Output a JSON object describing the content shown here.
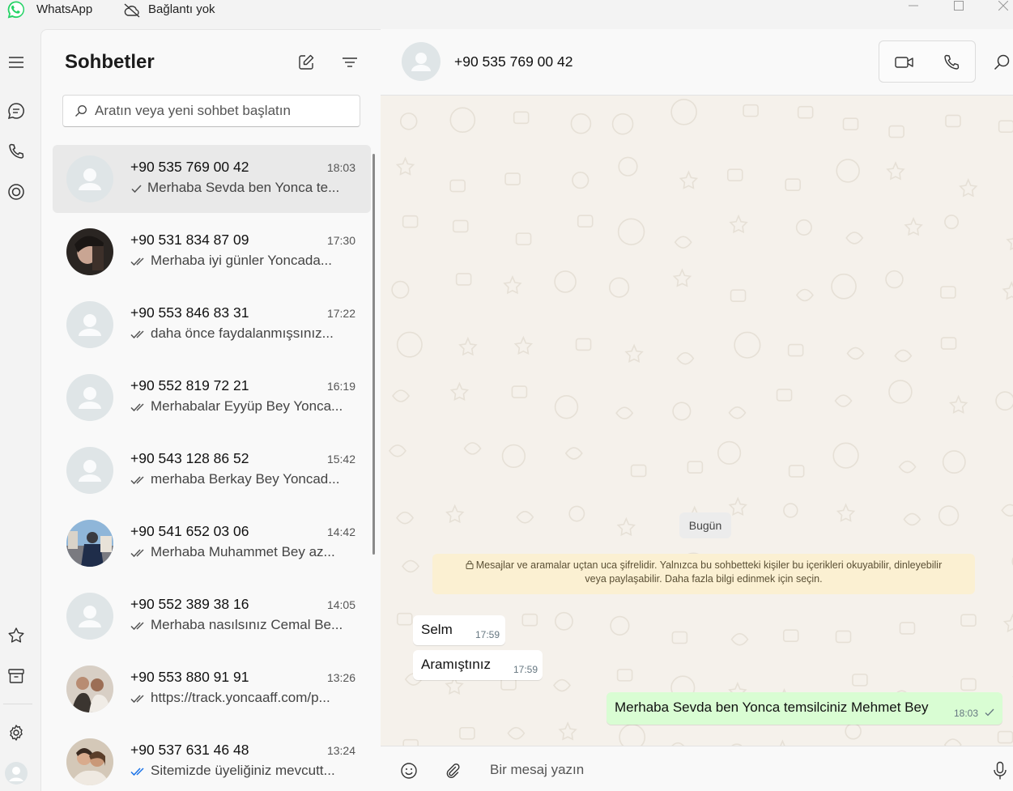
{
  "titlebar": {
    "app_name": "WhatsApp",
    "connection_status": "Bağlantı yok"
  },
  "colors": {
    "brand": "#25d366",
    "active_row": "#e9e9e9",
    "outgoing_bubble": "#d9fdd3",
    "read_tick": "#1a73e8",
    "encryption_banner": "#fbf0d2"
  },
  "rail": {
    "top_icons": [
      "menu-icon",
      "chats-icon",
      "calls-icon",
      "status-icon"
    ],
    "bottom_icons": [
      "starred-icon",
      "archive-icon",
      "settings-icon",
      "profile-icon"
    ]
  },
  "sidebar": {
    "title": "Sohbetler",
    "new_chat_icon": "compose-icon",
    "filter_icon": "filter-icon",
    "search_placeholder": "Aratın veya yeni sohbet başlatın",
    "chats": [
      {
        "name": "+90 535 769 00 42",
        "time": "18:03",
        "preview": "Merhaba Sevda ben Yonca te...",
        "tick": "single",
        "avatar": "default",
        "active": true
      },
      {
        "name": "+90 531 834 87 09",
        "time": "17:30",
        "preview": "Merhaba iyi günler Yoncada...",
        "tick": "double",
        "avatar": "photo-dark"
      },
      {
        "name": "+90 553 846 83 31",
        "time": "17:22",
        "preview": "daha önce faydalanmışsınız...",
        "tick": "double",
        "avatar": "default"
      },
      {
        "name": "+90 552 819 72 21",
        "time": "16:19",
        "preview": "Merhabalar Eyyüp Bey Yonca...",
        "tick": "double",
        "avatar": "default"
      },
      {
        "name": "+90 543 128 86 52",
        "time": "15:42",
        "preview": "merhaba Berkay Bey Yoncad...",
        "tick": "double",
        "avatar": "default"
      },
      {
        "name": "+90 541 652 03 06",
        "time": "14:42",
        "preview": "Merhaba Muhammet Bey az...",
        "tick": "double",
        "avatar": "photo-street"
      },
      {
        "name": "+90 552 389 38 16",
        "time": "14:05",
        "preview": "Merhaba nasılsınız Cemal Be...",
        "tick": "double",
        "avatar": "default"
      },
      {
        "name": "+90 553 880 91 91",
        "time": "13:26",
        "preview": "https://track.yoncaaff.com/p...",
        "tick": "double",
        "avatar": "photo-group"
      },
      {
        "name": "+90 537 631 46 48",
        "time": "13:24",
        "preview": "Sitemizde üyeliğiniz mevcutt...",
        "tick": "double-read",
        "avatar": "photo-couple"
      }
    ]
  },
  "conversation": {
    "contact_name": "+90 535 769 00 42",
    "header_icons": [
      "video-call-icon",
      "voice-call-icon",
      "search-icon"
    ],
    "date_chip": "Bugün",
    "encryption_notice_line1": "Mesajlar ve aramalar uçtan uca şifrelidir. Yalnızca bu sohbetteki kişiler bu içerikleri okuyabilir, dinleyebilir",
    "encryption_notice_line2": "veya paylaşabilir. Daha fazla bilgi edinmek için seçin.",
    "messages": [
      {
        "direction": "in",
        "text": "Selm",
        "time": "17:59"
      },
      {
        "direction": "in",
        "text": "Aramıştınız",
        "time": "17:59"
      },
      {
        "direction": "out",
        "text": "Merhaba Sevda ben Yonca temsilciniz Mehmet Bey",
        "time": "18:03",
        "tick": "single"
      }
    ],
    "composer_placeholder": "Bir mesaj yazın",
    "composer_icons": [
      "emoji-icon",
      "attach-icon",
      "microphone-icon"
    ]
  }
}
